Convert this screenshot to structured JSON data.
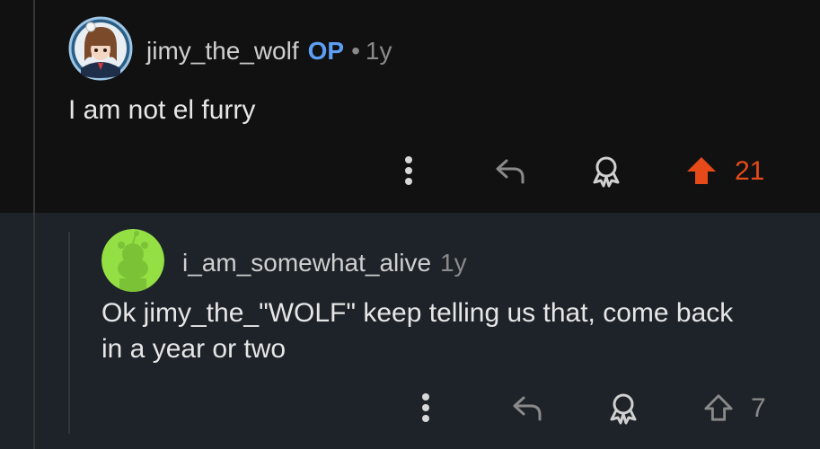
{
  "comments": [
    {
      "username": "jimy_the_wolf",
      "op_badge": "OP",
      "separator": "•",
      "age": "1y",
      "body": "I am not el furry",
      "score": "21",
      "upvoted": true,
      "avatar_icon": "anime-avatar-icon"
    },
    {
      "username": "i_am_somewhat_alive",
      "age": "1y",
      "body_line1": "Ok jimy_the_\"WOLF\" keep telling us that, come back",
      "body_line2": "in a year or two",
      "score": "7",
      "upvoted": false,
      "avatar_icon": "snoo-avatar-icon"
    }
  ],
  "colors": {
    "upvote_active": "#e64a19",
    "icon_gray": "#8a8a8a",
    "op_blue": "#5e9ff5",
    "reply_bg": "#1e2329"
  }
}
